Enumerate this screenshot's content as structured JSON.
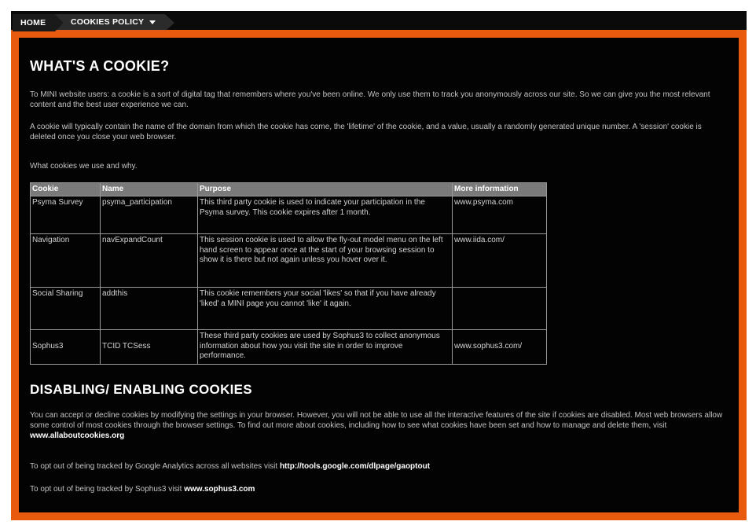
{
  "breadcrumb": {
    "home": "HOME",
    "policy": "COOKIES POLICY"
  },
  "section1": {
    "heading": "WHAT'S A COOKIE?",
    "para1": "To MINI website users: a cookie is a sort of digital tag that remembers where you've been online. We only use them to track you anonymously across our site. So we can give you the most relevant content and the best user experience we can.",
    "para2": "A cookie will typically contain the name of the domain from which the cookie has come, the 'lifetime' of the cookie, and a value, usually a randomly generated unique number. A 'session' cookie is deleted once you close your web browser.",
    "para3": "What cookies we use and why."
  },
  "table": {
    "headers": [
      "Cookie",
      "Name",
      "Purpose",
      "More information"
    ],
    "rows": [
      [
        "Psyma Survey",
        "psyma_participation",
        "This third party cookie is used to indicate your participation in the Psyma survey. This cookie expires after 1 month.",
        "www.psyma.com"
      ],
      [
        "Navigation",
        "navExpandCount",
        "This session cookie is used to allow the fly-out model menu on the left hand screen to appear once at the start of your browsing session to show it is there but not again unless you hover over it.",
        "www.iida.com/"
      ],
      [
        "Social Sharing",
        "addthis",
        "This cookie remembers your social 'likes' so that if you have already 'liked' a MINI page you cannot 'like' it again.",
        ""
      ],
      [
        "Sophus3",
        "TCID TCSess",
        "These third party cookies are used by Sophus3 to collect anonymous information about how you visit the site in order to improve performance.",
        "www.sophus3.com/"
      ]
    ]
  },
  "section2": {
    "heading": "DISABLING/ ENABLING COOKIES",
    "para1": "You can accept or decline cookies by modifying the settings in your browser. However, you will not be able to use all the interactive features of the site if cookies are disabled. Most web browsers allow some control of most cookies through the browser settings. To find out more about cookies, including how to see what cookies have been set and how to manage and delete them, visit ",
    "link1": "www.allaboutcookies.org",
    "para2": "To opt out of being tracked by Google Analytics across all websites visit ",
    "link2": "http://tools.google.com/dlpage/gaoptout",
    "para3": "To opt out of being tracked by Sophus3 visit ",
    "link3": "www.sophus3.com"
  },
  "colors": {
    "frame": "#e85b0f",
    "background": "#030303",
    "table_header": "#7a7a7a"
  }
}
